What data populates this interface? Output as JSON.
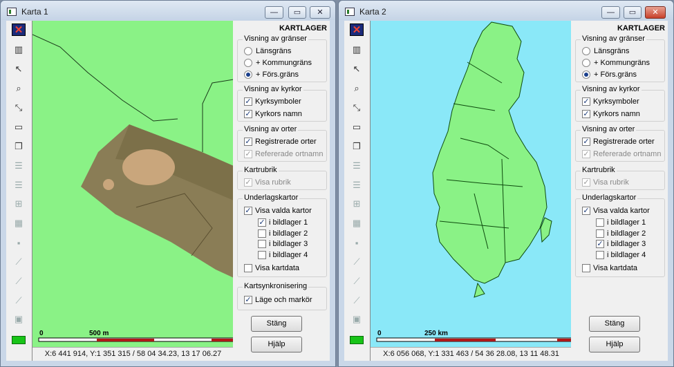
{
  "windows": [
    {
      "title": "Karta 1",
      "map": {
        "bg": "#8af286",
        "scale_zero": "0",
        "scale_label": "500 m",
        "coords": "X:6 441 914, Y:1 351 315 / 58 04 34.23, 13 17 06.27"
      },
      "panel": {
        "heading": "KARTLAGER",
        "border_group": {
          "title": "Visning av gränser",
          "options": [
            "Länsgräns",
            "+ Kommungräns",
            "+ Förs.gräns"
          ],
          "selected": 2
        },
        "church_group": {
          "title": "Visning av kyrkor",
          "symbols": "Kyrksymboler",
          "names": "Kyrkors namn"
        },
        "place_group": {
          "title": "Visning av orter",
          "registered": "Registrerade orter",
          "referenced": "Refererade ortnamn"
        },
        "rubric_group": {
          "title": "Kartrubrik",
          "show": "Visa rubrik"
        },
        "base_group": {
          "title": "Underlagskartor",
          "show_selected": "Visa valda kartor",
          "layers": [
            "i bildlager 1",
            "i bildlager 2",
            "i bildlager 3",
            "i bildlager 4"
          ],
          "checked": [
            true,
            false,
            false,
            false
          ],
          "show_data": "Visa kartdata"
        },
        "sync_group": {
          "title": "Kartsynkronisering",
          "position": "Läge och markör"
        },
        "close_button": "Stäng",
        "help_button": "Hjälp"
      }
    },
    {
      "title": "Karta 2",
      "map": {
        "bg": "#8ae8f8",
        "scale_zero": "0",
        "scale_label": "250 km",
        "coords": "X:6 056 068, Y:1 331 463 / 54 36 28.08, 13 11 48.31"
      },
      "panel": {
        "heading": "KARTLAGER",
        "border_group": {
          "title": "Visning av gränser",
          "options": [
            "Länsgräns",
            "+ Kommungräns",
            "+ Förs.gräns"
          ],
          "selected": 2
        },
        "church_group": {
          "title": "Visning av kyrkor",
          "symbols": "Kyrksymboler",
          "names": "Kyrkors namn"
        },
        "place_group": {
          "title": "Visning av orter",
          "registered": "Registrerade orter",
          "referenced": "Refererade ortnamn"
        },
        "rubric_group": {
          "title": "Kartrubrik",
          "show": "Visa rubrik"
        },
        "base_group": {
          "title": "Underlagskartor",
          "show_selected": "Visa valda kartor",
          "layers": [
            "i bildlager 1",
            "i bildlager 2",
            "i bildlager 3",
            "i bildlager 4"
          ],
          "checked": [
            false,
            false,
            true,
            false
          ],
          "show_data": "Visa kartdata"
        },
        "close_button": "Stäng",
        "help_button": "Hjälp"
      }
    }
  ],
  "titlebar_buttons": {
    "minimize": "—",
    "maximize": "▭",
    "close": "✕"
  },
  "tool_icons": [
    "close-x-icon",
    "layers-icon",
    "pointer-icon",
    "zoom-icon",
    "coordinate-icon",
    "ruler-icon",
    "copy-icon",
    "list-icon",
    "list-icon",
    "tree-icon",
    "grid-icon",
    "point-icon",
    "line-icon",
    "line-icon",
    "line-icon",
    "marker-icon",
    "green-swatch-icon"
  ],
  "colors": {
    "land": "#8af286",
    "sea": "#8ae8f8",
    "scale_red": "#b01818",
    "accent_close": "#c8402a"
  }
}
